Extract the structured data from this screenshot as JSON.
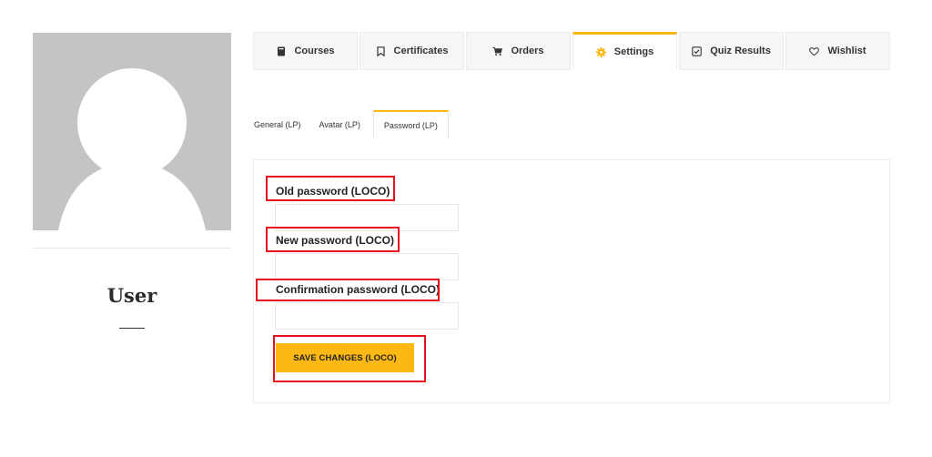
{
  "profile": {
    "name": "User"
  },
  "top_tabs": [
    {
      "label": "Courses",
      "icon": "book-icon"
    },
    {
      "label": "Certificates",
      "icon": "bookmark-icon"
    },
    {
      "label": "Orders",
      "icon": "cart-icon"
    },
    {
      "label": "Settings",
      "icon": "gear-icon",
      "active": true
    },
    {
      "label": "Quiz Results",
      "icon": "checkbox-icon"
    },
    {
      "label": "Wishlist",
      "icon": "heart-icon"
    }
  ],
  "sub_tabs": [
    {
      "label": "General (LP)"
    },
    {
      "label": "Avatar (LP)"
    },
    {
      "label": "Password (LP)",
      "active": true
    }
  ],
  "form": {
    "old_password_label": "Old password (LOCO)",
    "new_password_label": "New password (LOCO)",
    "confirm_password_label": "Confirmation password (LOCO)",
    "old_password_value": "",
    "new_password_value": "",
    "confirm_password_value": "",
    "save_label": "SAVE CHANGES (LOCO)"
  },
  "colors": {
    "accent": "#fdb813",
    "highlight_box": "#e3121b",
    "avatar_bg": "#c4c4c4"
  }
}
